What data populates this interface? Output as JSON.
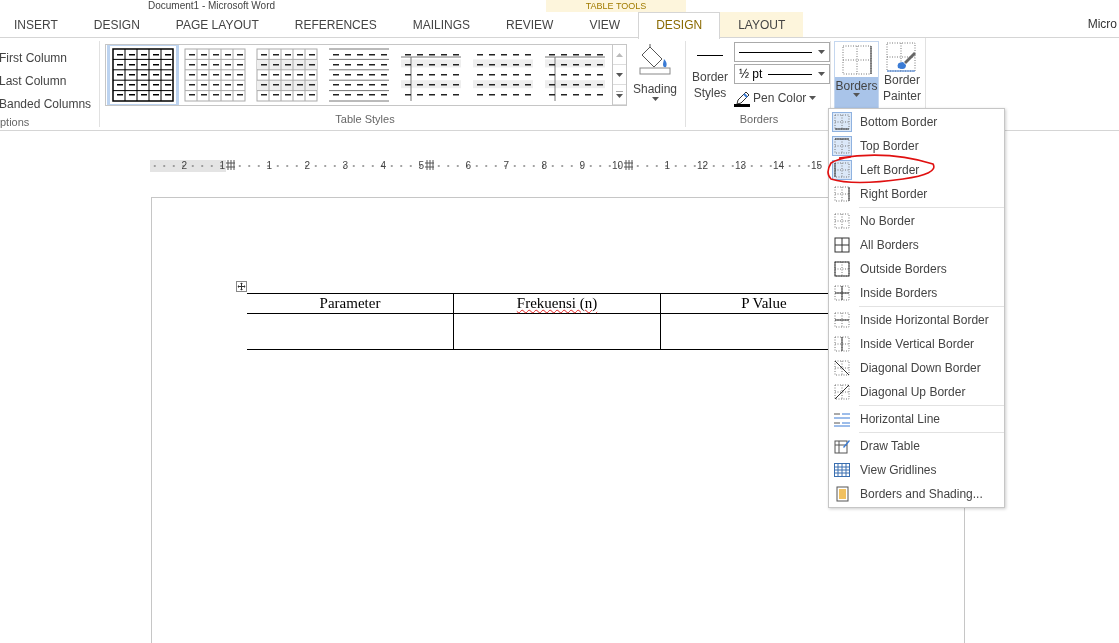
{
  "title_bar": {
    "title": "Document1 - Microsoft Word",
    "context_label": "TABLE TOOLS"
  },
  "tabs": [
    {
      "label": "INSERT",
      "selected": false,
      "contextual": false
    },
    {
      "label": "DESIGN",
      "selected": false,
      "contextual": false
    },
    {
      "label": "PAGE LAYOUT",
      "selected": false,
      "contextual": false
    },
    {
      "label": "REFERENCES",
      "selected": false,
      "contextual": false
    },
    {
      "label": "MAILINGS",
      "selected": false,
      "contextual": false
    },
    {
      "label": "REVIEW",
      "selected": false,
      "contextual": false
    },
    {
      "label": "VIEW",
      "selected": false,
      "contextual": false
    },
    {
      "label": "DESIGN",
      "selected": true,
      "contextual": true
    },
    {
      "label": "LAYOUT",
      "selected": false,
      "contextual": true
    }
  ],
  "account": "Micro",
  "ribbon": {
    "options_group": {
      "items": [
        "First Column",
        "Last Column",
        "Banded Columns"
      ],
      "label": "ptions"
    },
    "styles_group": {
      "label": "Table Styles",
      "styles": [
        {
          "selected": true
        },
        {
          "selected": false
        },
        {
          "selected": false
        },
        {
          "selected": false
        },
        {
          "selected": false
        },
        {
          "selected": false
        },
        {
          "selected": false
        }
      ]
    },
    "shading": {
      "label": "Shading"
    },
    "borders_group": {
      "label": "Borders",
      "border_styles": "Border Styles",
      "weight": "½ pt",
      "pen_color": "Pen Color"
    },
    "borders_button": {
      "label": "Borders",
      "open": true
    },
    "border_painter": {
      "label": "Border Painter"
    }
  },
  "ruler": {
    "segments": [
      {
        "shaded": true,
        "numbers": [
          "2",
          "1"
        ]
      },
      {
        "shaded": false,
        "numbers": [
          "1",
          "2",
          "3",
          "4",
          "5"
        ]
      },
      {
        "shaded": false,
        "numbers": [
          "6",
          "7",
          "8",
          "9",
          "10"
        ]
      },
      {
        "shaded": false,
        "numbers": [
          "1",
          "12",
          "13",
          "14",
          "15"
        ]
      }
    ]
  },
  "table": {
    "headers": [
      {
        "text": "Parameter",
        "misspelled": false
      },
      {
        "text": "Frekuensi (n)",
        "misspelled": true
      },
      {
        "text": "P Value",
        "misspelled": false
      }
    ]
  },
  "menu": {
    "groups": [
      [
        {
          "label": "Bottom Border",
          "checked": true,
          "circled": false
        },
        {
          "label": "Top Border",
          "checked": true,
          "circled": false
        },
        {
          "label": "Left Border",
          "checked": true,
          "circled": true
        },
        {
          "label": "Right Border",
          "checked": false,
          "circled": false
        }
      ],
      [
        {
          "label": "No Border",
          "checked": false,
          "circled": false
        },
        {
          "label": "All Borders",
          "checked": false,
          "circled": false
        },
        {
          "label": "Outside Borders",
          "checked": false,
          "circled": false
        },
        {
          "label": "Inside Borders",
          "checked": false,
          "circled": false
        }
      ],
      [
        {
          "label": "Inside Horizontal Border",
          "checked": false,
          "circled": false
        },
        {
          "label": "Inside Vertical Border",
          "checked": false,
          "circled": false
        },
        {
          "label": "Diagonal Down Border",
          "checked": false,
          "circled": false
        },
        {
          "label": "Diagonal Up Border",
          "checked": false,
          "circled": false
        }
      ],
      [
        {
          "label": "Horizontal Line",
          "checked": false,
          "circled": false
        }
      ],
      [
        {
          "label": "Draw Table",
          "checked": false,
          "circled": false
        },
        {
          "label": "View Gridlines",
          "checked": false,
          "circled": false
        },
        {
          "label": "Borders and Shading...",
          "checked": false,
          "circled": false
        }
      ]
    ]
  }
}
